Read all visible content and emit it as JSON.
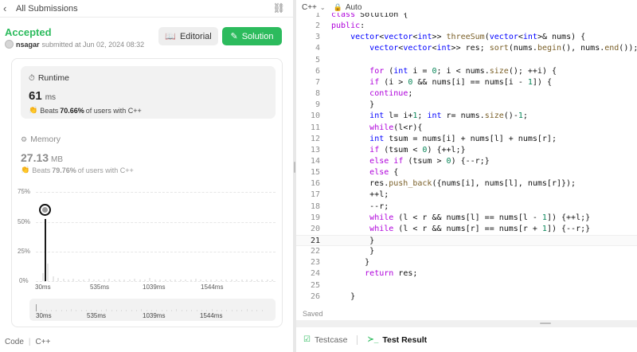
{
  "left_panel": {
    "header": {
      "back_icon": "‹",
      "title": "All Submissions",
      "link_icon": "⛓"
    },
    "status": "Accepted",
    "submitter": {
      "user": "nsagar",
      "text": "submitted at Jun 02, 2024 08:32"
    },
    "buttons": {
      "editorial": {
        "icon": "📖",
        "label": "Editorial"
      },
      "solution": {
        "icon": "✎",
        "label": "Solution"
      }
    },
    "runtime": {
      "icon": "⏱",
      "title": "Runtime",
      "value": "61",
      "unit": "ms",
      "beats_icon": "👏",
      "beats_prefix": "Beats",
      "beats_value": "70.66%",
      "beats_suffix": "of users with C++"
    },
    "memory": {
      "icon": "⚙",
      "title": "Memory",
      "value": "27.13",
      "unit": "MB",
      "beats_icon": "👏",
      "beats_prefix": "Beats",
      "beats_value": "79.76%",
      "beats_suffix": "of users with C++"
    },
    "distribution": {
      "y_ticks": [
        "75%",
        "50%",
        "25%",
        "0%"
      ],
      "x_ticks": [
        "30ms",
        "535ms",
        "1039ms",
        "1544ms"
      ],
      "overview_ticks": [
        "30ms",
        "535ms",
        "1039ms",
        "1544ms"
      ]
    },
    "footer": {
      "left": "Code",
      "right": "C++"
    }
  },
  "editor": {
    "language": "C++",
    "chevron": "⌄",
    "lock_icon": "🔒",
    "mode": "Auto",
    "current_line": 21,
    "lines": [
      {
        "n": 1,
        "text": "class Solution {"
      },
      {
        "n": 2,
        "text": "public:"
      },
      {
        "n": 3,
        "text": "    vector<vector<int>> threeSum(vector<int>& nums) {"
      },
      {
        "n": 4,
        "text": "        vector<vector<int>> res; sort(nums.begin(), nums.end());"
      },
      {
        "n": 5,
        "text": ""
      },
      {
        "n": 6,
        "text": "        for (int i = 0; i < nums.size(); ++i) {"
      },
      {
        "n": 7,
        "text": "        if (i > 0 && nums[i] == nums[i - 1]) {"
      },
      {
        "n": 8,
        "text": "        continue;"
      },
      {
        "n": 9,
        "text": "        }"
      },
      {
        "n": 10,
        "text": "        int l= i+1; int r= nums.size()-1;"
      },
      {
        "n": 11,
        "text": "        while(l<r){"
      },
      {
        "n": 12,
        "text": "        int tsum = nums[i] + nums[l] + nums[r];"
      },
      {
        "n": 13,
        "text": "        if (tsum < 0) {++l;}"
      },
      {
        "n": 14,
        "text": "        else if (tsum > 0) {--r;}"
      },
      {
        "n": 15,
        "text": "        else {"
      },
      {
        "n": 16,
        "text": "        res.push_back({nums[i], nums[l], nums[r]});"
      },
      {
        "n": 17,
        "text": "        ++l;"
      },
      {
        "n": 18,
        "text": "        --r;"
      },
      {
        "n": 19,
        "text": "        while (l < r && nums[l] == nums[l - 1]) {++l;}"
      },
      {
        "n": 20,
        "text": "        while (l < r && nums[r] == nums[r + 1]) {--r;}"
      },
      {
        "n": 21,
        "text": "        }"
      },
      {
        "n": 22,
        "text": "        }"
      },
      {
        "n": 23,
        "text": "       }"
      },
      {
        "n": 24,
        "text": "       return res;"
      },
      {
        "n": 25,
        "text": ""
      },
      {
        "n": 26,
        "text": "    }"
      }
    ],
    "status": "Saved"
  },
  "bottom_tabs": {
    "testcase": {
      "icon": "☑",
      "label": "Testcase"
    },
    "test_result": {
      "icon": "≻_",
      "label": "Test Result"
    }
  },
  "colors": {
    "accent": "#2cbb5d",
    "keyword": "#af00db",
    "type": "#0000ff",
    "function": "#795e26",
    "number": "#098658"
  }
}
